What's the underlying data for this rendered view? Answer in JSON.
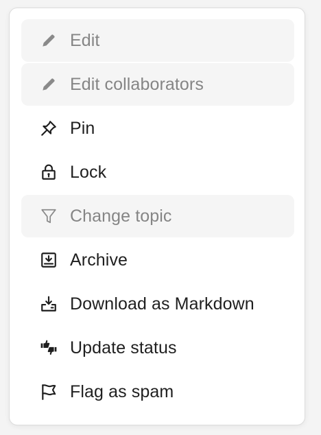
{
  "menu": {
    "items": [
      {
        "label": "Edit",
        "icon": "pencil-icon",
        "disabled": true
      },
      {
        "label": "Edit collaborators",
        "icon": "pencil-icon",
        "disabled": true
      },
      {
        "label": "Pin",
        "icon": "pin-icon",
        "disabled": false
      },
      {
        "label": "Lock",
        "icon": "lock-icon",
        "disabled": false
      },
      {
        "label": "Change topic",
        "icon": "filter-icon",
        "disabled": true
      },
      {
        "label": "Archive",
        "icon": "archive-icon",
        "disabled": false
      },
      {
        "label": "Download as Markdown",
        "icon": "download-icon",
        "disabled": false
      },
      {
        "label": "Update status",
        "icon": "thumbs-status-icon",
        "disabled": false
      },
      {
        "label": "Flag as spam",
        "icon": "flag-icon",
        "disabled": false
      }
    ]
  },
  "colors": {
    "text": "#1f1f1f",
    "disabled_text": "#858585",
    "disabled_background": "#f5f5f5",
    "menu_border": "#dcdcdc"
  }
}
